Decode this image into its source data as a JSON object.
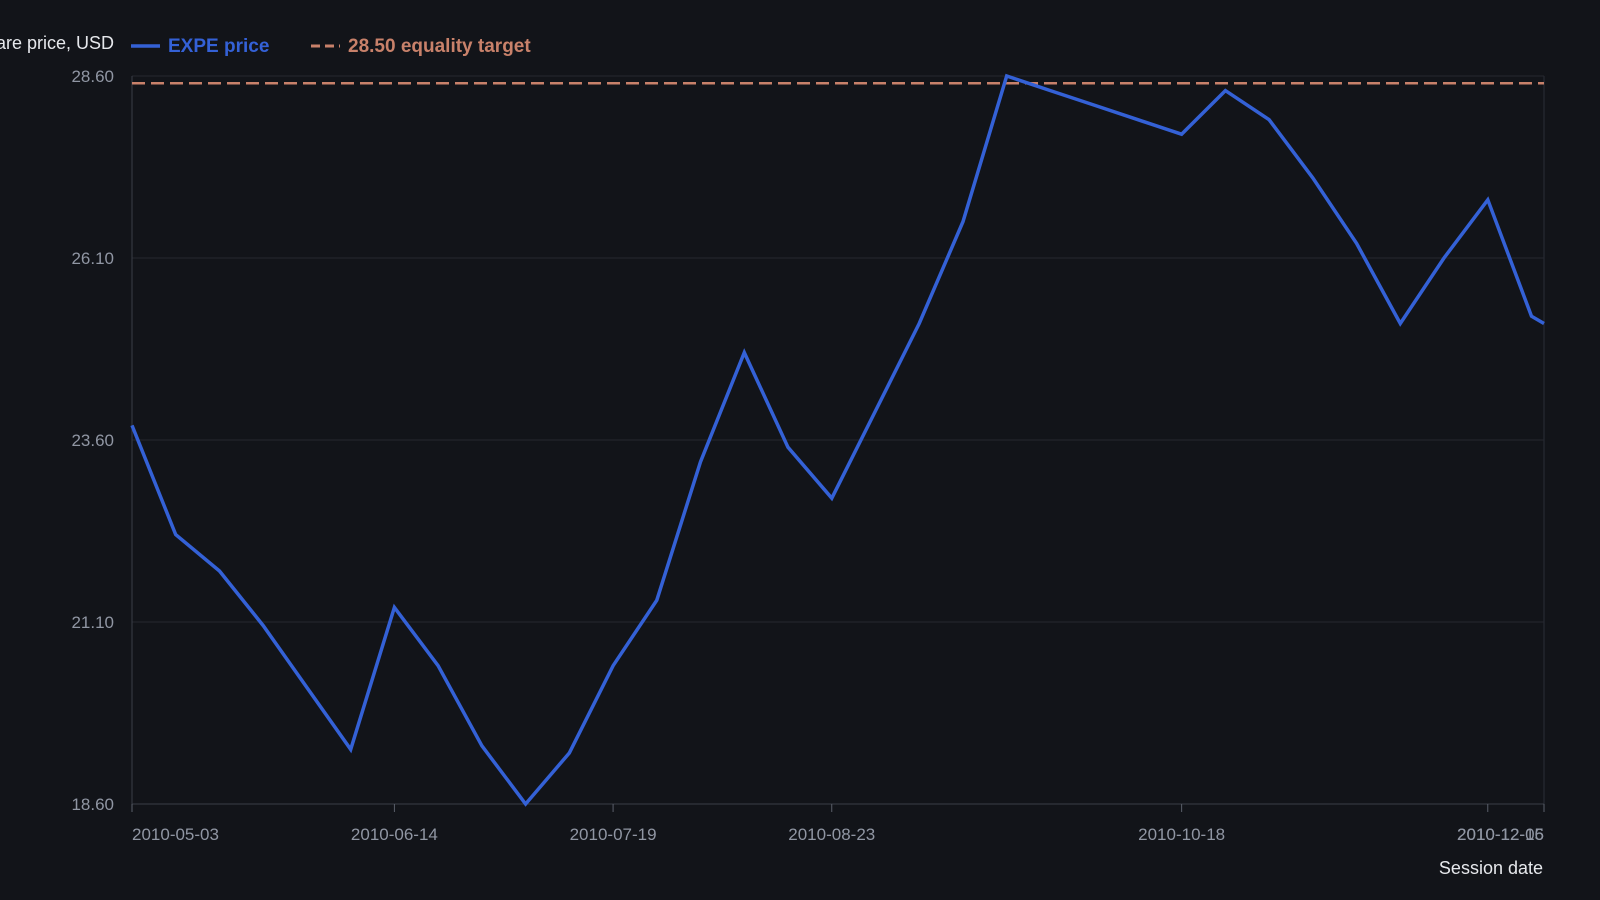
{
  "chart_data": {
    "type": "line",
    "ylabel": "Share price, USD",
    "xlabel": "Session date",
    "ylim": [
      18.6,
      28.6
    ],
    "yticks": [
      "18.60",
      "21.10",
      "23.60",
      "26.10",
      "28.60"
    ],
    "xticks": [
      "2010-05-03",
      "2010-06-14",
      "2010-07-19",
      "2010-08-23",
      "2010-10-18",
      "2010-12-06",
      "2010-12-15"
    ],
    "grid": "horizontal",
    "legend_position": "top",
    "series": [
      {
        "name": "EXPE price",
        "color": "#3461d6",
        "x": [
          "2010-05-03",
          "2010-05-10",
          "2010-05-17",
          "2010-05-24",
          "2010-05-31",
          "2010-06-07",
          "2010-06-14",
          "2010-06-21",
          "2010-06-28",
          "2010-07-05",
          "2010-07-12",
          "2010-07-19",
          "2010-07-26",
          "2010-08-02",
          "2010-08-09",
          "2010-08-16",
          "2010-08-23",
          "2010-08-30",
          "2010-09-06",
          "2010-09-13",
          "2010-09-20",
          "2010-09-27",
          "2010-10-04",
          "2010-10-11",
          "2010-10-18",
          "2010-10-25",
          "2010-11-01",
          "2010-11-08",
          "2010-11-15",
          "2010-11-22",
          "2010-11-29",
          "2010-12-06",
          "2010-12-13",
          "2010-12-15"
        ],
        "y": [
          23.8,
          22.3,
          21.8,
          21.05,
          20.2,
          19.35,
          21.3,
          20.5,
          19.4,
          18.6,
          19.3,
          20.5,
          21.4,
          23.3,
          24.8,
          23.5,
          22.8,
          24.0,
          25.2,
          26.6,
          28.6,
          28.4,
          28.2,
          28.0,
          27.8,
          28.4,
          28.0,
          27.2,
          26.3,
          25.2,
          26.1,
          26.9,
          25.3,
          25.2
        ]
      }
    ],
    "reference_lines": [
      {
        "name": "28.50 equality target",
        "value": 28.5,
        "color": "#c8816a",
        "style": "dashed"
      }
    ]
  }
}
